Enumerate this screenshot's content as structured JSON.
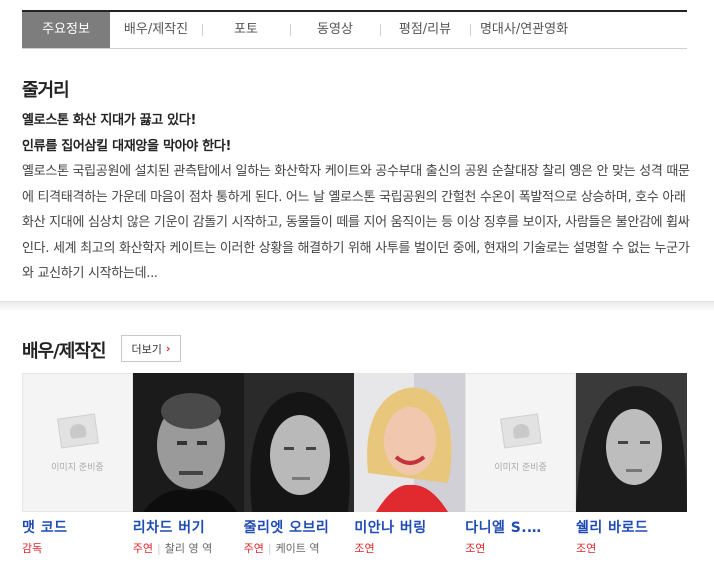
{
  "tabs": [
    {
      "label": "주요정보",
      "active": true
    },
    {
      "label": "배우/제작진"
    },
    {
      "label": "포토"
    },
    {
      "label": "동영상"
    },
    {
      "label": "평점/리뷰"
    },
    {
      "label": "명대사/연관영화"
    }
  ],
  "synopsis": {
    "title": "줄거리",
    "lead1": "옐로스톤 화산 지대가 끓고 있다!",
    "lead2": "인류를 집어삼킬 대재앙을 막아야 한다!",
    "body": "옐로스톤 국립공원에 설치된 관측탑에서 일하는 화산학자 케이트와 공수부대 출신의 공원 순찰대장 찰리 옝은 안 맞는 성격 때문에 티격태격하는 가운데 마음이 점차 통하게 된다. 어느 날 옐로스톤 국립공원의 간헐천 수온이 폭발적으로 상승하며, 호수 아래 화산 지대에 심상치 않은 기운이 감돌기 시작하고, 동물들이 떼를 지어 움직이는 등 이상 징후를 보이자, 사람들은 불안감에 휩싸인다. 세계 최고의 화산학자 케이트는 이러한 상황을 해결하기 위해 사투를 벌이던 중에, 현재의 기술로는 설명할 수 없는 누군가와 교신하기 시작하는데..."
  },
  "cast_section": {
    "title": "배우/제작진",
    "more_label": "더보기",
    "no_image_label": "이미지 준비중"
  },
  "cast": [
    {
      "name": "맷 코드",
      "kind": "감독",
      "role": ""
    },
    {
      "name": "리차드 버기",
      "kind": "주연",
      "role": "찰리 영 역"
    },
    {
      "name": "줄리엣 오브리",
      "kind": "주연",
      "role": "케이트 역"
    },
    {
      "name": "미안나 버링",
      "kind": "조연",
      "role": ""
    },
    {
      "name": "다니엘 S.…",
      "kind": "조연",
      "role": ""
    },
    {
      "name": "쉘리 바로드",
      "kind": "조연",
      "role": ""
    }
  ]
}
